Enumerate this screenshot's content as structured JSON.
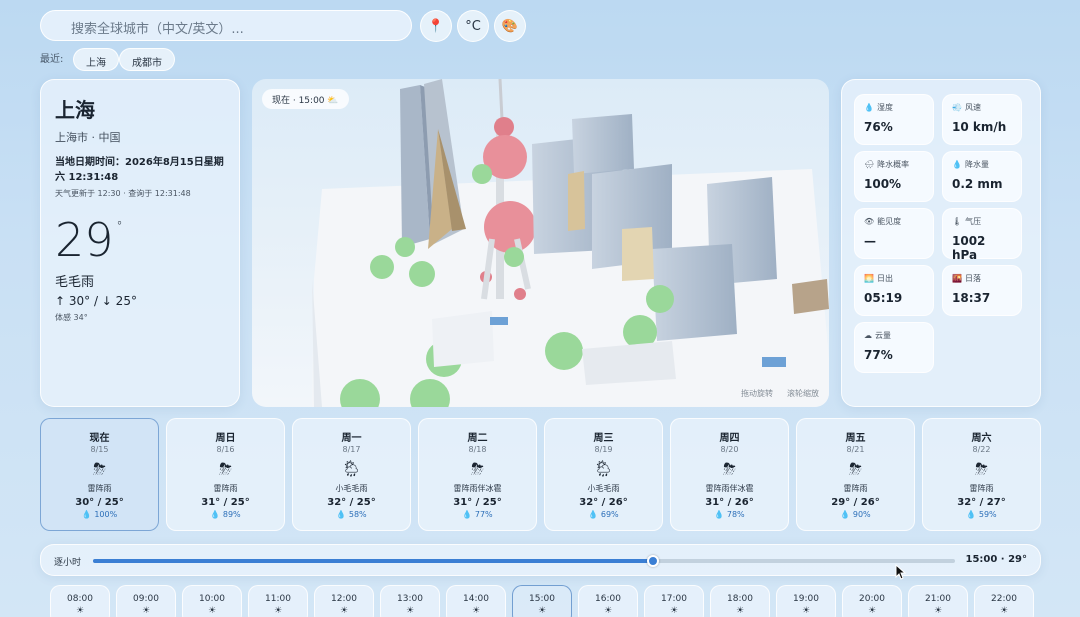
{
  "search": {
    "placeholder": "搜索全球城市（中文/英文）..."
  },
  "top_buttons": {
    "location_icon": "📍",
    "unit": "°C",
    "theme_icon": "🎨"
  },
  "recent": {
    "label": "最近:",
    "items": [
      "上海",
      "成都市"
    ]
  },
  "current": {
    "city": "上海",
    "region": "上海市 · 中国",
    "local_time": "当地日期时间：2026年8月15日星期六 12:31:48",
    "updated": "天气更新于 12:30 · 查询于 12:31:48",
    "temp": "29",
    "unit": "°",
    "condition": "毛毛雨",
    "hilo": "↑ 30° / ↓ 25°",
    "feels": "体感 34°"
  },
  "scene": {
    "badge": "现在 · 15:00",
    "badge_icon": "⛅",
    "hint_rotate": "拖动旋转",
    "hint_zoom": "滚轮缩放"
  },
  "metrics": [
    {
      "icon": "💧",
      "label": "湿度",
      "value": "76%"
    },
    {
      "icon": "💨",
      "label": "风速",
      "value": "10 km/h"
    },
    {
      "icon": "🌧",
      "label": "降水概率",
      "value": "100%"
    },
    {
      "icon": "💧",
      "label": "降水量",
      "value": "0.2 mm"
    },
    {
      "icon": "👁",
      "label": "能见度",
      "value": "—"
    },
    {
      "icon": "🌡",
      "label": "气压",
      "value": "1002 hPa"
    },
    {
      "icon": "🌅",
      "label": "日出",
      "value": "05:19"
    },
    {
      "icon": "🌇",
      "label": "日落",
      "value": "18:37"
    },
    {
      "icon": "☁",
      "label": "云量",
      "value": "77%"
    }
  ],
  "days": [
    {
      "name": "现在",
      "date": "8/15",
      "icon": "⛈",
      "cond": "雷阵雨",
      "temp": "30° / 25°",
      "precip": "💧 100%"
    },
    {
      "name": "周日",
      "date": "8/16",
      "icon": "⛈",
      "cond": "雷阵雨",
      "temp": "31° / 25°",
      "precip": "💧 89%"
    },
    {
      "name": "周一",
      "date": "8/17",
      "icon": "🌦",
      "cond": "小毛毛雨",
      "temp": "32° / 25°",
      "precip": "💧 58%"
    },
    {
      "name": "周二",
      "date": "8/18",
      "icon": "⛈",
      "cond": "雷阵雨伴冰雹",
      "temp": "31° / 25°",
      "precip": "💧 77%"
    },
    {
      "name": "周三",
      "date": "8/19",
      "icon": "🌦",
      "cond": "小毛毛雨",
      "temp": "32° / 26°",
      "precip": "💧 69%"
    },
    {
      "name": "周四",
      "date": "8/20",
      "icon": "⛈",
      "cond": "雷阵雨伴冰雹",
      "temp": "31° / 26°",
      "precip": "💧 78%"
    },
    {
      "name": "周五",
      "date": "8/21",
      "icon": "⛈",
      "cond": "雷阵雨",
      "temp": "29° / 26°",
      "precip": "💧 90%"
    },
    {
      "name": "周六",
      "date": "8/22",
      "icon": "⛈",
      "cond": "雷阵雨",
      "temp": "32° / 27°",
      "precip": "💧 59%"
    }
  ],
  "slider": {
    "label": "逐小时",
    "value_text": "15:00 · 29°",
    "progress": 0.65
  },
  "hours": [
    {
      "time": "08:00",
      "icon": "☀"
    },
    {
      "time": "09:00",
      "icon": "☀"
    },
    {
      "time": "10:00",
      "icon": "☀"
    },
    {
      "time": "11:00",
      "icon": "☀"
    },
    {
      "time": "12:00",
      "icon": "☀"
    },
    {
      "time": "13:00",
      "icon": "☀"
    },
    {
      "time": "14:00",
      "icon": "☀"
    },
    {
      "time": "15:00",
      "icon": "☀"
    },
    {
      "time": "16:00",
      "icon": "☀"
    },
    {
      "time": "17:00",
      "icon": "☀"
    },
    {
      "time": "18:00",
      "icon": "☀"
    },
    {
      "time": "19:00",
      "icon": "☀"
    },
    {
      "time": "20:00",
      "icon": "☀"
    },
    {
      "time": "21:00",
      "icon": "☀"
    },
    {
      "time": "22:00",
      "icon": "☀"
    }
  ]
}
